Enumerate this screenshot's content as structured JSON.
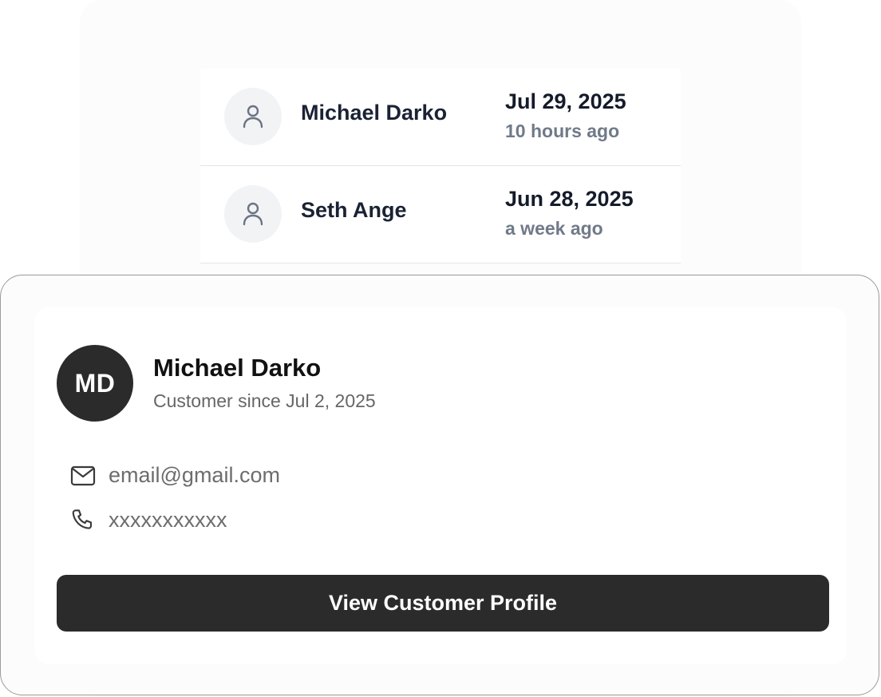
{
  "customers": [
    {
      "name": "Michael Darko",
      "date": "Jul 29, 2025",
      "relative": "10 hours ago",
      "icon": "user-icon"
    },
    {
      "name": "Seth Ange",
      "date": "Jun 28, 2025",
      "relative": "a week ago",
      "icon": "user-icon"
    }
  ],
  "card": {
    "initials": "MD",
    "name": "Michael Darko",
    "since": "Customer since Jul 2, 2025",
    "email": "email@gmail.com",
    "email_icon": "mail-icon",
    "phone": "xxxxxxxxxxx",
    "phone_icon": "phone-icon",
    "button_label": "View Customer Profile"
  },
  "colors": {
    "dark": "#2b2b2b",
    "text_primary": "#1a2233",
    "text_muted": "#707a88",
    "avatar_bg": "#f2f3f5",
    "divider": "#e3e5e8"
  }
}
